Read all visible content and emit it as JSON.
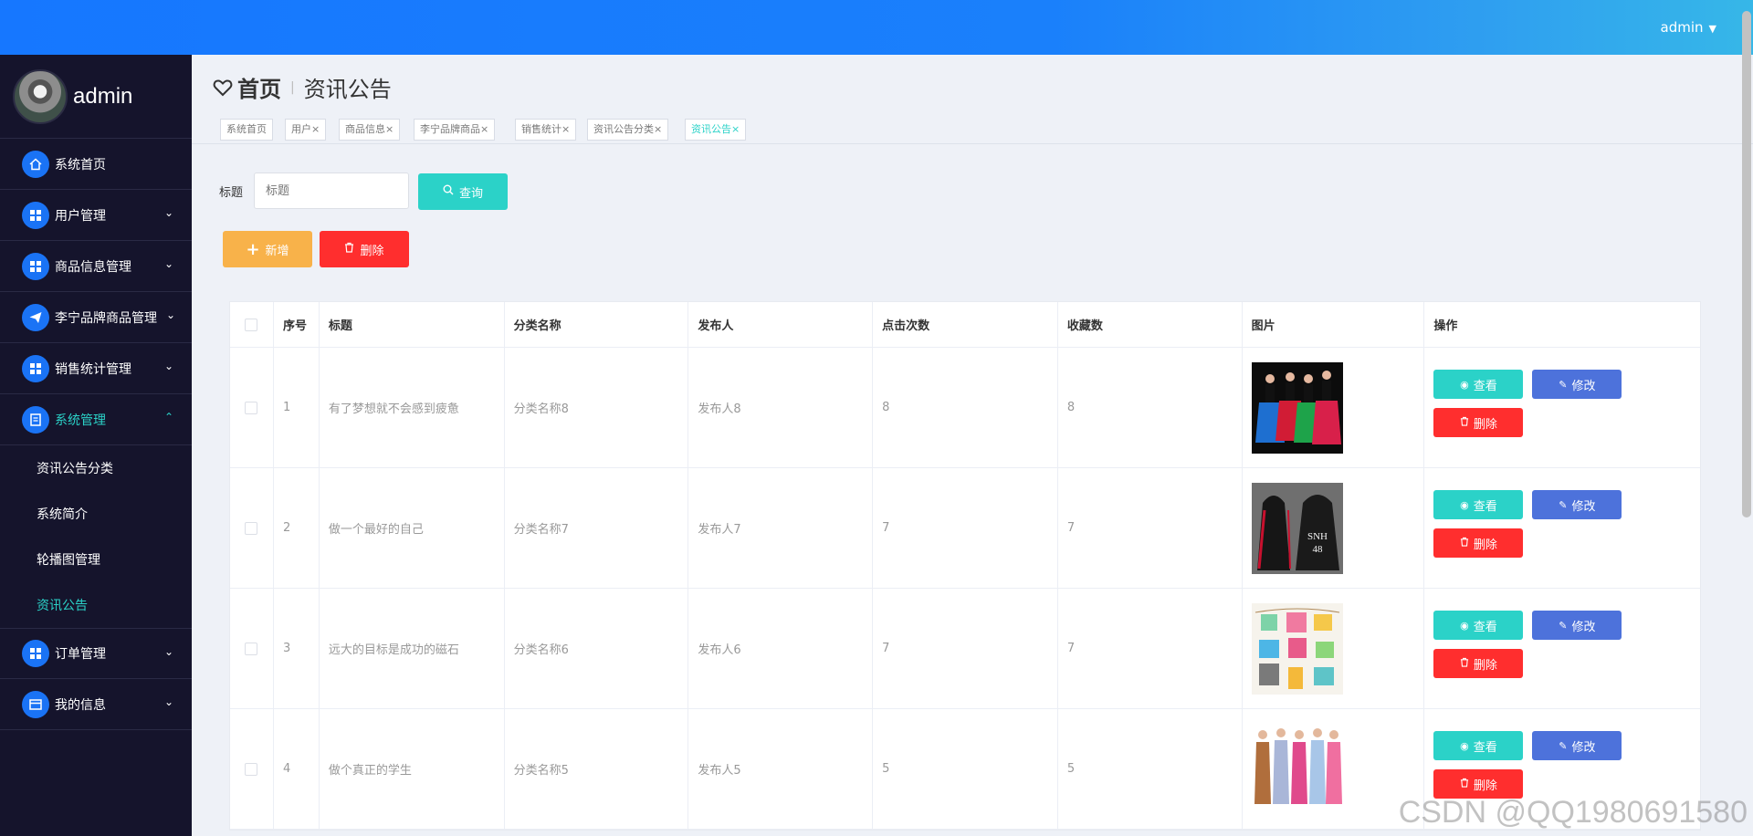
{
  "topbar": {
    "username": "admin",
    "caret": "▼"
  },
  "sidebar": {
    "profile_name": "admin",
    "items": [
      {
        "label": "系统首页",
        "icon": "home-icon",
        "expandable": false
      },
      {
        "label": "用户管理",
        "icon": "grid-icon",
        "expandable": true
      },
      {
        "label": "商品信息管理",
        "icon": "grid-icon",
        "expandable": true
      },
      {
        "label": "李宁品牌商品管理",
        "icon": "send-icon",
        "expandable": true
      },
      {
        "label": "销售统计管理",
        "icon": "grid-icon",
        "expandable": true
      },
      {
        "label": "系统管理",
        "icon": "document-icon",
        "expandable": true,
        "open": true
      },
      {
        "label": "订单管理",
        "icon": "grid-icon",
        "expandable": true
      },
      {
        "label": "我的信息",
        "icon": "card-icon",
        "expandable": true
      }
    ],
    "sub_items": [
      "资讯公告分类",
      "系统简介",
      "轮播图管理",
      "资讯公告"
    ],
    "arrow_down": "⌄",
    "arrow_up": "⌃"
  },
  "breadcrumb": {
    "home": "首页",
    "current": "资讯公告"
  },
  "tags": [
    {
      "label": "系统首页"
    },
    {
      "label": "用户×"
    },
    {
      "label": "商品信息×"
    },
    {
      "label": "李宁品牌商品×"
    },
    {
      "label": "销售统计×"
    },
    {
      "label": "资讯公告分类×"
    },
    {
      "label": "资讯公告×"
    }
  ],
  "search": {
    "label": "标题",
    "placeholder": "标题",
    "query_button": "查询"
  },
  "actions": {
    "add_button": "新增",
    "delete_button": "删除"
  },
  "table": {
    "columns": [
      "序号",
      "标题",
      "分类名称",
      "发布人",
      "点击次数",
      "收藏数",
      "图片",
      "操作"
    ],
    "rows": [
      {
        "no": "1",
        "title": "有了梦想就不会感到疲惫",
        "category": "分类名称8",
        "publisher": "发布人8",
        "clicks": "8",
        "favorites": "8",
        "image": "dancers-photo"
      },
      {
        "no": "2",
        "title": "做一个最好的自己",
        "category": "分类名称7",
        "publisher": "发布人7",
        "clicks": "7",
        "favorites": "7",
        "image": "jacket-photo"
      },
      {
        "no": "3",
        "title": "远大的目标是成功的磁石",
        "category": "分类名称6",
        "publisher": "发布人6",
        "clicks": "7",
        "favorites": "7",
        "image": "kids-clothes-photo"
      },
      {
        "no": "4",
        "title": "做个真正的学生",
        "category": "分类名称5",
        "publisher": "发布人5",
        "clicks": "5",
        "favorites": "5",
        "image": "dresses-photo"
      }
    ],
    "op_view": "查看",
    "op_edit": "修改",
    "op_delete": "删除"
  },
  "jacket_text": [
    "SNH",
    "48"
  ],
  "watermark": "CSDN @QQ1980691580",
  "colors": {
    "accent": "#2bd2c8",
    "primary": "#1677ff",
    "danger": "#ff2e2e",
    "warning": "#f8b24a",
    "edit": "#4d72db",
    "sidebar": "#15142c"
  }
}
